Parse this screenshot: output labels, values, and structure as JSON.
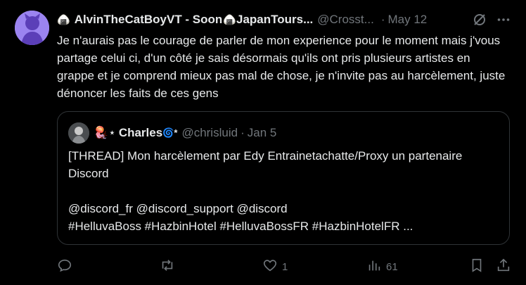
{
  "tweet": {
    "author_name": "AlvinTheCatBoyVT - Soon",
    "author_name_tail": "JapanTours...",
    "handle": "@Crosst...",
    "date": "May 12",
    "text": "Je n'aurais pas le courage de parler de mon experience pour le moment mais j'vous partage celui ci, d'un côté je sais désormais qu'ils ont pris plusieurs artistes en grappe et je comprend mieux pas mal de chose, je n'invite pas au harcèlement, juste dénoncer les faits de ces gens"
  },
  "quote": {
    "name_prefix": "🪼⋆",
    "name": "Charles",
    "name_suffix": "🌀*",
    "handle": "@chrisluid",
    "date": "Jan 5",
    "line1": "[THREAD] Mon harcèlement par Edy Entrainetachatte/Proxy un partenaire Discord",
    "line2": "@discord_fr @discord_support @discord",
    "line3": "#HelluvaBoss #HazbinHotel #HelluvaBossFR #HazbinHotelFR ..."
  },
  "actions": {
    "reply_count": "",
    "retweet_count": "",
    "like_count": "1",
    "views_count": "61"
  },
  "icons": [
    "onigiri-icon",
    "grok-icon",
    "more-icon",
    "reply-icon",
    "retweet-icon",
    "like-icon",
    "views-icon",
    "bookmark-icon",
    "share-icon"
  ]
}
